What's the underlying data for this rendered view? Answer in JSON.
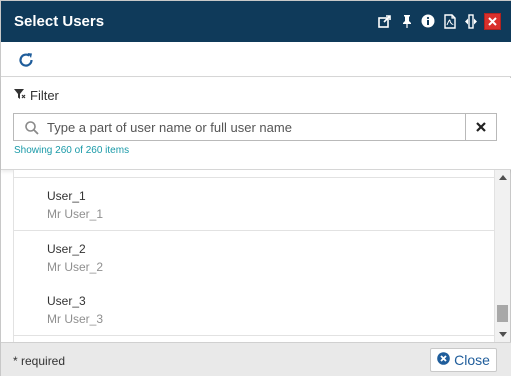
{
  "dialog": {
    "title": "Select Users",
    "title_icons": [
      "external-link-icon",
      "pin-icon",
      "info-icon",
      "pdf-icon",
      "resize-icon",
      "close-icon"
    ]
  },
  "toolbar": {
    "refresh_icon": "refresh-icon"
  },
  "filter": {
    "label": "Filter",
    "icon": "filter-icon",
    "search_placeholder": "Type a part of user name or full user name",
    "search_value": "",
    "count_text": "Showing 260 of 260 items"
  },
  "list": {
    "items": [
      {
        "name": "User_1",
        "full_name": "Mr User_1"
      },
      {
        "name": "User_2",
        "full_name": "Mr User_2"
      },
      {
        "name": "User_3",
        "full_name": "Mr User_3"
      }
    ]
  },
  "footer": {
    "required_text": "* required",
    "close_label": "Close"
  },
  "colors": {
    "titlebar": "#0f3a5a",
    "close_red": "#d9302c",
    "accent_blue": "#1f5d9b",
    "count_teal": "#1a9aa8"
  }
}
